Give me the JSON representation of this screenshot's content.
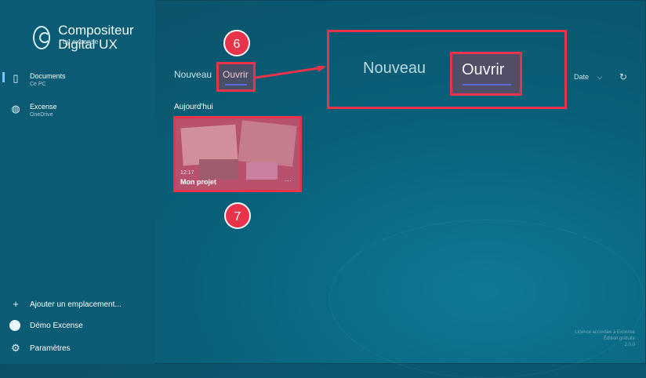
{
  "app": {
    "title": "Compositeur Digital UX",
    "subtitle": "by excense"
  },
  "sidebar": {
    "items": [
      {
        "label": "Documents",
        "sub": "Ce PC",
        "icon": "tablet-icon"
      },
      {
        "label": "Excense",
        "sub": "OneDrive",
        "icon": "globe-icon"
      }
    ],
    "bottom": [
      {
        "label": "Ajouter un emplacement...",
        "icon": "plus-icon"
      },
      {
        "label": "Démo Excense",
        "icon": "user-avatar-icon"
      },
      {
        "label": "Paramètres",
        "icon": "gear-icon"
      }
    ]
  },
  "tabs": {
    "new": "Nouveau",
    "open": "Ouvrir"
  },
  "zoom": {
    "new": "Nouveau",
    "open": "Ouvrir"
  },
  "toolbar": {
    "sort": "Date",
    "sort_chevron": "⌵"
  },
  "section": {
    "title": "Aujourd'hui"
  },
  "project": {
    "time": "12:17",
    "name": "Mon projet",
    "more": "···"
  },
  "badges": {
    "step6": "6",
    "step7": "7"
  },
  "footer": {
    "line1": "Licence accordée à Excense",
    "line2": "Édition gratuite",
    "line3": "2.0.0"
  },
  "colors": {
    "highlight": "#e8334a",
    "underline": "#5b6ad9"
  }
}
